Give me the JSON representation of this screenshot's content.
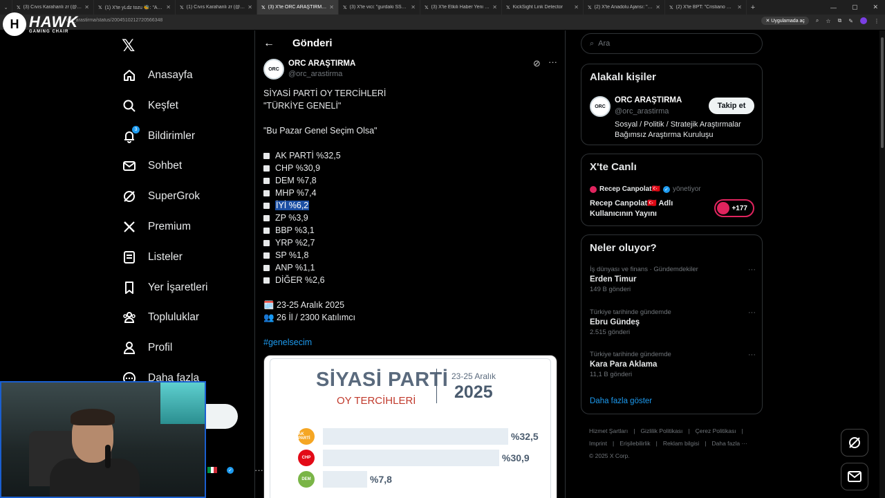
{
  "browser": {
    "tabs": [
      {
        "title": "(3) Cıvıs Karahanlı zr (@karahan",
        "active": false
      },
      {
        "title": "(1) X'te yLdz tozu 🐝: \"Asla ev...",
        "active": false
      },
      {
        "title": "(1) Cıvıs Karahanlı zr (@karahan",
        "active": false
      },
      {
        "title": "(3) X'te ORC ARAŞTIRMA: \"SİYA",
        "active": true
      },
      {
        "title": "(3) X'te vici: \"gurdaki SSD (1tb d",
        "active": false
      },
      {
        "title": "(3) X'te Etkili Haber Yeni Sayfa:",
        "active": false
      },
      {
        "title": "KickSight Link Detector",
        "active": false
      },
      {
        "title": "(2) X'te Anadolu Ajansı: \"Kuzu",
        "active": false
      },
      {
        "title": "(2) X'te BPT: \"Cristiano Ronaldo",
        "active": false
      }
    ],
    "url": "orc_arastirma/status/2004510212720566348",
    "app_pill": "Uygulamada aç"
  },
  "overlay": {
    "logo_title": "HAWK",
    "logo_sub": "GAMING CHAIR",
    "logo_mark": "H"
  },
  "sidebar": {
    "items": [
      {
        "label": "Anasayfa",
        "icon": "home-icon"
      },
      {
        "label": "Keşfet",
        "icon": "search-icon"
      },
      {
        "label": "Bildirimler",
        "icon": "bell-icon",
        "badge": "3"
      },
      {
        "label": "Sohbet",
        "icon": "mail-icon"
      },
      {
        "label": "SuperGrok",
        "icon": "grok-icon"
      },
      {
        "label": "Premium",
        "icon": "x-icon"
      },
      {
        "label": "Listeler",
        "icon": "list-icon"
      },
      {
        "label": "Yer İşaretleri",
        "icon": "bookmark-icon"
      },
      {
        "label": "Topluluklar",
        "icon": "communities-icon"
      },
      {
        "label": "Profil",
        "icon": "person-icon"
      },
      {
        "label": "Daha fazla",
        "icon": "more-circle-icon"
      }
    ],
    "post_button": "a"
  },
  "main": {
    "header_title": "Gönderi",
    "author_name": "ORC ARAŞTIRMA",
    "author_handle": "@orc_arastirma",
    "avatar_text": "ORC",
    "lines": [
      "SİYASİ PARTİ OY TERCİHLERİ",
      "\"TÜRKİYE GENELİ\"",
      "",
      "\"Bu Pazar Genel Seçim Olsa\"",
      ""
    ],
    "results": [
      "AK PARTİ %32,5",
      "CHP %30,9",
      "DEM %7,8",
      "MHP %7,4",
      "İYİ %6,2",
      "ZP %3,9",
      "BBP %3,1",
      "YRP %2,7",
      "SP %1,8",
      "ANP %1,1",
      "DİĞER %2,6"
    ],
    "highlighted_index": 4,
    "date_line": "🗓️ 23-25 Aralık 2025",
    "sample_line": "👥 26 İl / 2300 Katılımcı",
    "hashtag": "#genelsecim",
    "image": {
      "title": "SİYASİ PARTİ",
      "subtitle": "OY TERCİHLERİ",
      "date": "23-25 Aralık",
      "year": "2025",
      "bars": [
        {
          "party": "AK PARTİ",
          "value": 32.5,
          "label": "%32,5",
          "color": "#f5a623"
        },
        {
          "party": "CHP",
          "value": 30.9,
          "label": "%30,9",
          "color": "#e30a17"
        },
        {
          "party": "DEM",
          "value": 7.8,
          "label": "%7,8",
          "color": "#7ab547"
        }
      ]
    }
  },
  "right": {
    "search_placeholder": "Ara",
    "related_title": "Alakalı kişiler",
    "related": {
      "name": "ORC ARAŞTIRMA",
      "handle": "@orc_arastirma",
      "bio": "Sosyal / Politik / Stratejik Araştırmalar Bağımsız Araştırma Kuruluşu",
      "follow": "Takip et",
      "avatar_text": "ORC"
    },
    "live_title": "X'te Canlı",
    "live": {
      "host": "Recep Canpolat🇹🇷",
      "role": "yönetiyor",
      "title": "Recep Canpolat🇹🇷 Adlı Kullanıcının Yayını",
      "count": "+177"
    },
    "trends_title": "Neler oluyor?",
    "trends": [
      {
        "meta": "İş dünyası ve finans · Gündemdekiler",
        "name": "Erden Timur",
        "count": "149 B gönderi"
      },
      {
        "meta": "Türkiye tarihinde gündemde",
        "name": "Ebru Gündeş",
        "count": "2.515 gönderi"
      },
      {
        "meta": "Türkiye tarihinde gündemde",
        "name": "Kara Para Aklama",
        "count": "11,1 B gönderi"
      }
    ],
    "show_more": "Daha fazla göster",
    "footer": [
      "Hizmet Şartları",
      "|",
      "Gizlilik Politikası",
      "|",
      "Çerez Politikası",
      "|",
      "Imprint",
      "|",
      "Erişilebilirlik",
      "|",
      "Reklam bilgisi",
      "|",
      "Daha fazla ···",
      "© 2025 X Corp."
    ]
  }
}
